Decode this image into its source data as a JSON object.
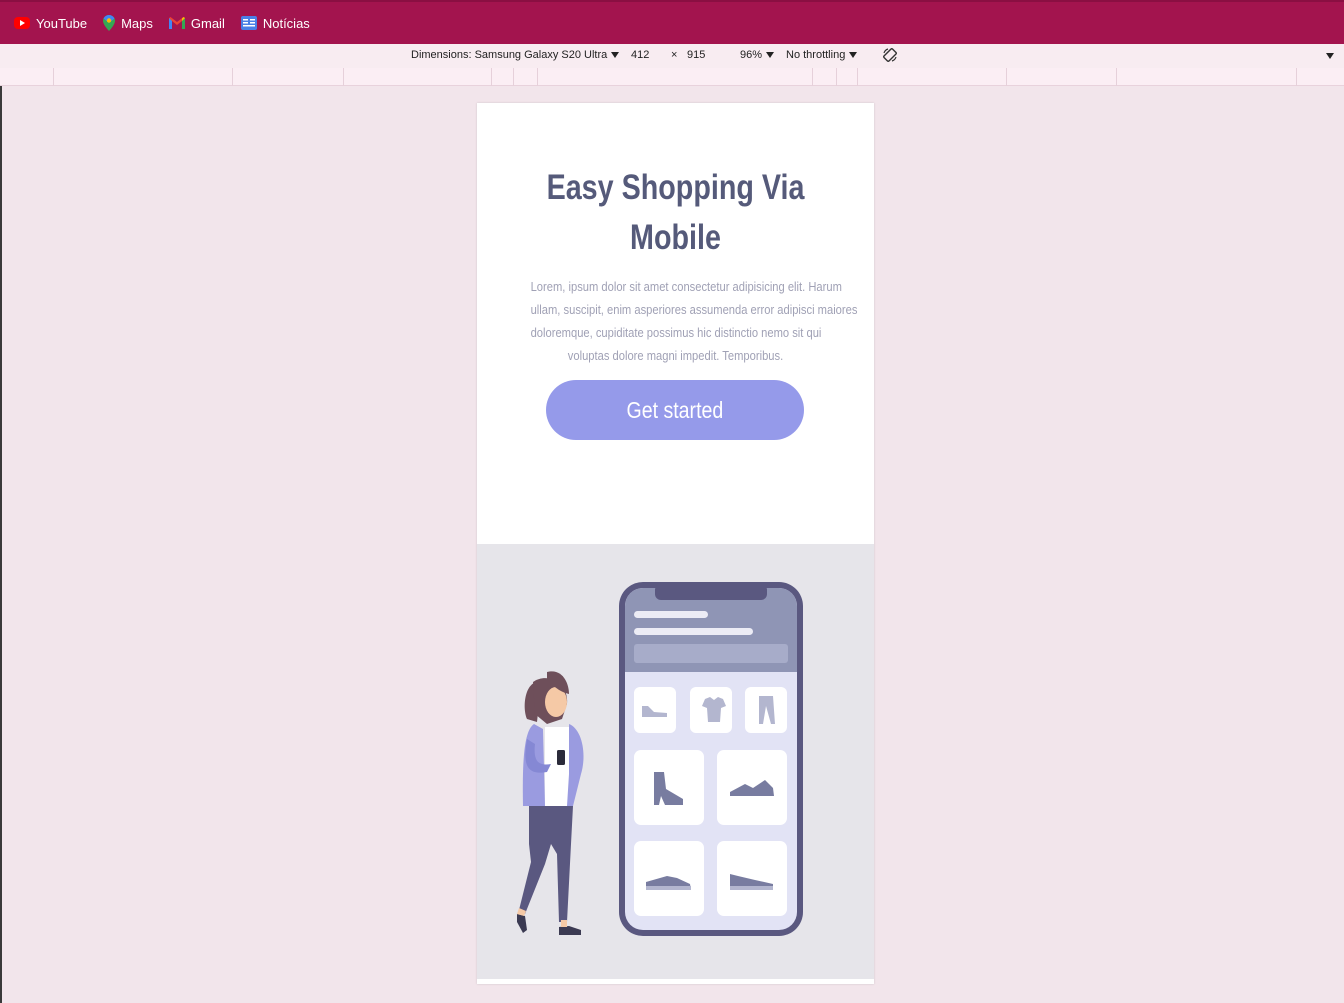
{
  "bookmarks": [
    {
      "label": "YouTube",
      "icon": "youtube-icon"
    },
    {
      "label": "Maps",
      "icon": "maps-icon"
    },
    {
      "label": "Gmail",
      "icon": "gmail-icon"
    },
    {
      "label": "Notícias",
      "icon": "news-icon"
    }
  ],
  "devtools": {
    "dimensions_label": "Dimensions: Samsung Galaxy S20 Ultra",
    "width": "412",
    "times": "×",
    "height": "915",
    "zoom": "96%",
    "throttling": "No throttling"
  },
  "page": {
    "title_line1": "Easy Shopping Via",
    "title_line2": "Mobile",
    "text_lines": [
      "Lorem, ipsum dolor sit amet consectetur adipisicing elit. Harum",
      "ullam, suscipit, enim asperiores assumenda error adipisci maiores",
      "doloremque, cupiditate possimus hic distinctio nemo sit qui",
      "voluptas dolore magni impedit. Temporibus."
    ],
    "cta_label": "Get started"
  },
  "colors": {
    "bookmarks_bar": "#a3144e",
    "devbar": "#f8ecf1",
    "background": "#f2e5eb",
    "title": "#555a7a",
    "body_text": "#a0a1b5",
    "button": "#959aea",
    "illustration_bg": "#e6e5ea",
    "phone_frame": "#5a5880"
  }
}
